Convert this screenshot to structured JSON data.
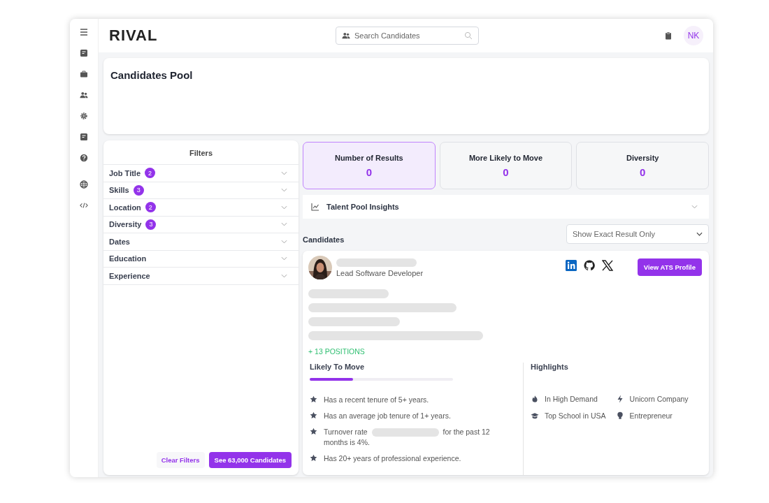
{
  "logo": "RIVAL",
  "header": {
    "search_placeholder": "Search Candidates",
    "avatar": "NK"
  },
  "page_title": "Candidates Pool",
  "filters": {
    "title": "Filters",
    "items": [
      {
        "label": "Job Title",
        "count": "2",
        "expanded": false
      },
      {
        "label": "Skills",
        "count": "3",
        "expanded": false
      },
      {
        "label": "Location",
        "count": "2",
        "expanded": false
      },
      {
        "label": "Diversity",
        "count": "3",
        "expanded": false
      },
      {
        "label": "Dates",
        "expanded": false
      },
      {
        "label": "Education",
        "expanded": false
      },
      {
        "label": "Experience",
        "expanded": false
      }
    ],
    "clear_button": "Clear Filters",
    "apply_button": "See 63,000 Candidates"
  },
  "stats": [
    {
      "label": "Number of Results",
      "value": "0",
      "selected": true
    },
    {
      "label": "More Likely to Move",
      "value": "0",
      "selected": false
    },
    {
      "label": "Diversity",
      "value": "0",
      "selected": false
    }
  ],
  "insights": {
    "title": "Talent Pool Insights",
    "expanded": false
  },
  "candidates": {
    "title": "Candidates",
    "filter_select": "Show Exact Result Only",
    "card": {
      "role": "Lead Software Developer",
      "profile_button": "View ATS Profile",
      "positions": "+ 13 POSITIONS",
      "likely_to_move": {
        "title": "Likely To Move",
        "level": 0.3,
        "reasons": [
          {
            "text": "Has a recent tenure of 5+ years."
          },
          {
            "text": "Has an average job tenure of 1+ years."
          },
          {
            "text": "Turnover rate",
            "hidden_part": true,
            "text_after": "for the past 12 months is 4%."
          },
          {
            "text": "Has 20+ years of professional experience."
          }
        ]
      },
      "highlights": {
        "title": "Highlights",
        "items": [
          {
            "kind": "fire",
            "label": "In High Demand"
          },
          {
            "kind": "bolt",
            "label": "Unicorn Company"
          },
          {
            "kind": "school",
            "label": "Top School in USA"
          },
          {
            "kind": "bulb",
            "label": "Entrepreneur"
          }
        ]
      }
    }
  }
}
